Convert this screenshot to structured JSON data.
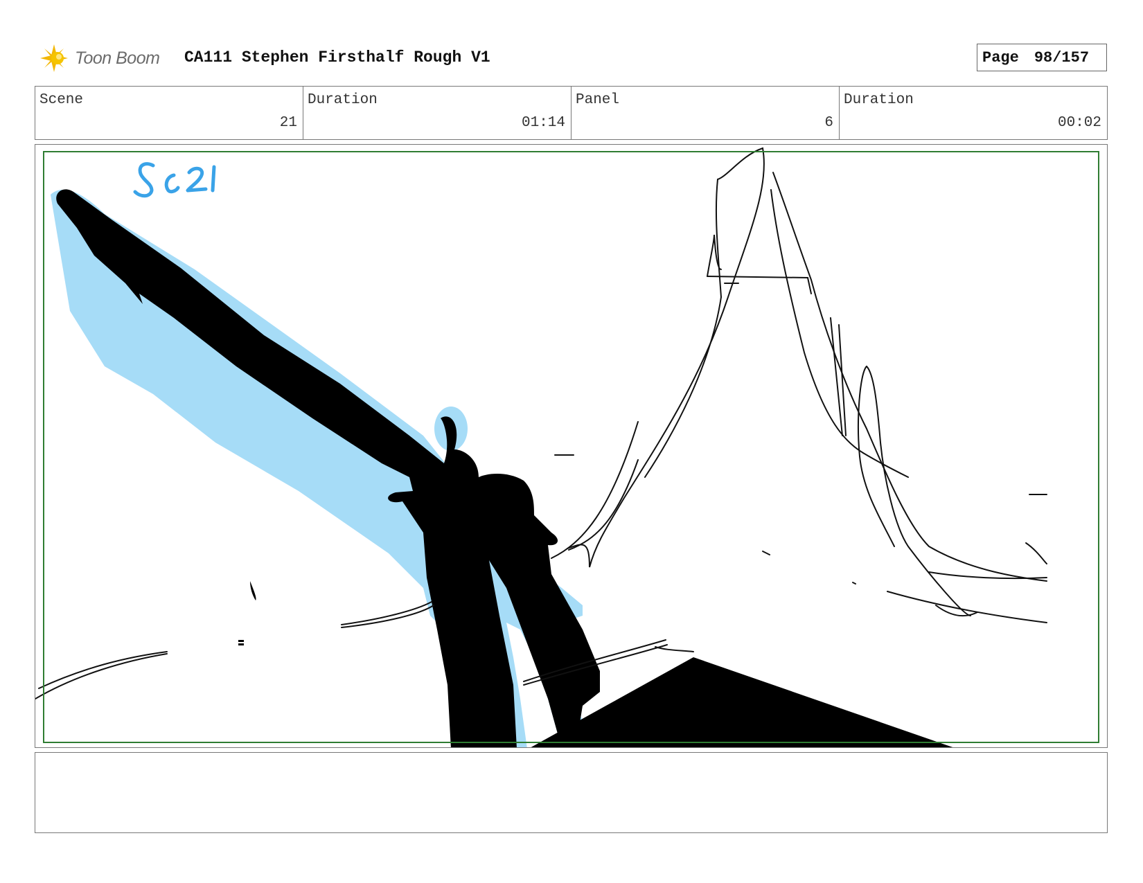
{
  "header": {
    "logo_text": "Toon Boom",
    "title": "CA111 Stephen Firsthalf Rough V1",
    "page_label": "Page",
    "page_value": "98/157"
  },
  "info": {
    "scene_label": "Scene",
    "scene_value": "21",
    "scene_duration_label": "Duration",
    "scene_duration_value": "01:14",
    "panel_label": "Panel",
    "panel_value": "6",
    "panel_duration_label": "Duration",
    "panel_duration_value": "00:02"
  },
  "panel": {
    "handwritten_note": "Sc 21",
    "note_color": "#3aa3e8",
    "highlight_color": "#a6dcf7",
    "safe_frame_color": "#2f7d32"
  },
  "notes": {
    "text": ""
  }
}
